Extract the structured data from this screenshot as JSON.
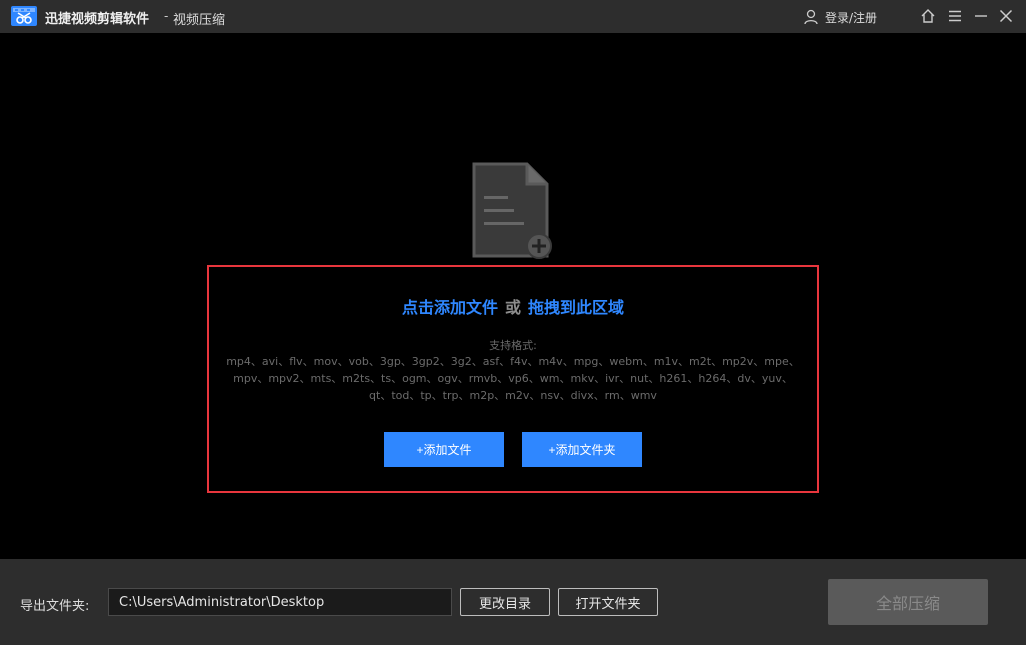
{
  "titlebar": {
    "app_name": "迅捷视频剪辑软件",
    "separator": "-",
    "section": "视频压缩",
    "login_label": "登录/注册",
    "icons": [
      "app-logo-icon",
      "user-icon",
      "home-icon",
      "menu-icon",
      "minimize-icon",
      "close-icon"
    ]
  },
  "drop_area": {
    "click_add": "点击添加文件",
    "or": "或",
    "drag_here": "拖拽到此区域",
    "formats_label": "支持格式:",
    "formats": "mp4、avi、flv、mov、vob、3gp、3gp2、3g2、asf、f4v、m4v、mpg、webm、m1v、m2t、mp2v、mpe、mpv、mpv2、mts、m2ts、ts、ogm、ogv、rmvb、vp6、wm、mkv、ivr、nut、h261、h264、dv、yuv、qt、tod、tp、trp、m2p、m2v、nsv、divx、rm、wmv",
    "add_file_button": "+添加文件",
    "add_folder_button": "+添加文件夹",
    "highlight_color": "#e8363d",
    "link_color": "#2f87ff"
  },
  "bottombar": {
    "output_label": "导出文件夹:",
    "output_path": "C:\\Users\\Administrator\\Desktop",
    "change_dir_button": "更改目录",
    "open_folder_button": "打开文件夹",
    "compress_all_button": "全部压缩"
  }
}
